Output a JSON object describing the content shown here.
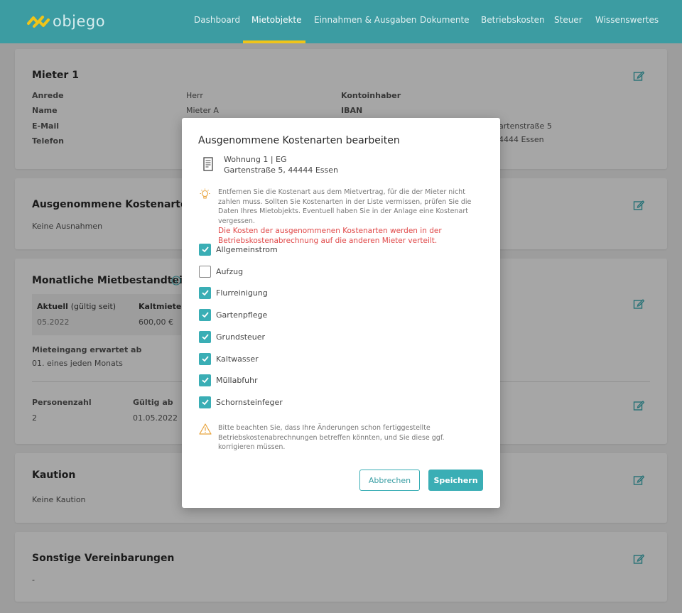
{
  "brand": {
    "name": "objego",
    "accent": "#3c9ca2",
    "highlight": "#f0c419"
  },
  "nav": {
    "items": [
      {
        "label": "Dashboard"
      },
      {
        "label": "Mietobjekte",
        "active": true
      },
      {
        "label": "Einnahmen & Ausgaben"
      },
      {
        "label": "Dokumente"
      },
      {
        "label": "Betriebskosten"
      },
      {
        "label": "Steuer"
      },
      {
        "label": "Wissenswertes"
      }
    ]
  },
  "mieter": {
    "title": "Mieter 1",
    "labels": {
      "anrede": "Anrede",
      "name": "Name",
      "email": "E-Mail",
      "telefon": "Telefon",
      "kontoinhaber": "Kontoinhaber",
      "iban": "IBAN"
    },
    "values": {
      "anrede": "Herr",
      "name": "Mieter A",
      "address_partial": "artenstraße 5",
      "city_partial": "4444 Essen"
    }
  },
  "ausgenommene": {
    "title": "Ausgenommene Kostenarten",
    "value": "Keine Ausnahmen"
  },
  "monatlich": {
    "title": "Monatliche Mietbestandteile",
    "aktuell_label": "Aktuell",
    "aktuell_suffix": "(gültig seit)",
    "aktuell_value": "05.2022",
    "kaltmiete_label": "Kaltmiete",
    "kaltmiete_value": "600,00 €",
    "eingang_label": "Mieteingang erwartet ab",
    "eingang_value": "01. eines jeden Monats",
    "personen_label": "Personenzahl",
    "personen_value": "2",
    "gueltig_label": "Gültig ab",
    "gueltig_value": "01.05.2022"
  },
  "kaution": {
    "title": "Kaution",
    "value": "Keine Kaution"
  },
  "sonstige": {
    "title": "Sonstige Vereinbarungen",
    "value": "-"
  },
  "modal": {
    "title": "Ausgenommene Kostenarten bearbeiten",
    "property_line1": "Wohnung 1 | EG",
    "property_line2": "Gartenstraße 5, 44444 Essen",
    "hint": "Entfernen Sie die Kostenart aus dem Mietvertrag, für die der Mieter nicht zahlen muss. Sollten Sie Kostenarten in der Liste vermissen, prüfen Sie die Daten Ihres Mietobjekts. Eventuell haben Sie in der Anlage eine Kostenart vergessen.",
    "hint_red": "Die Kosten der ausgenommenen Kostenarten werden in der Betriebskostenabrechnung auf die anderen Mieter verteilt.",
    "options": [
      {
        "label": "Allgemeinstrom",
        "checked": true
      },
      {
        "label": "Aufzug",
        "checked": false
      },
      {
        "label": "Flurreinigung",
        "checked": true
      },
      {
        "label": "Gartenpflege",
        "checked": true
      },
      {
        "label": "Grundsteuer",
        "checked": true
      },
      {
        "label": "Kaltwasser",
        "checked": true
      },
      {
        "label": "Müllabfuhr",
        "checked": true
      },
      {
        "label": "Schornsteinfeger",
        "checked": true
      }
    ],
    "warning": "Bitte beachten Sie, dass Ihre Änderungen schon fertiggestellte Betriebskostenabrechnungen betreffen könnten, und Sie diese ggf. korrigieren müssen.",
    "cancel_label": "Abbrechen",
    "save_label": "Speichern"
  }
}
